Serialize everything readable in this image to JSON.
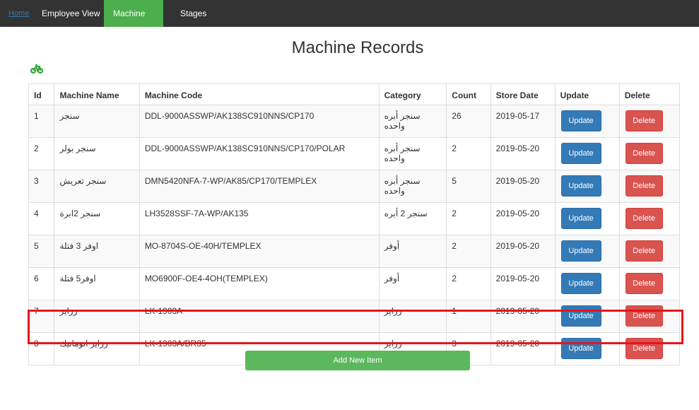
{
  "nav": {
    "home": "Home",
    "employee_view": "Employee View",
    "machine_view": "Machine View",
    "stages": "Stages"
  },
  "page_title": "Machine Records",
  "icon": "bicycle-icon",
  "table": {
    "headers": [
      "Id",
      "Machine Name",
      "Machine Code",
      "Category",
      "Count",
      "Store Date",
      "Update",
      "Delete"
    ],
    "rows": [
      {
        "id": "1",
        "name": "سنجر",
        "code": "DDL-9000ASSWP/AK138SC910NNS/CP170",
        "category": "سنجر أبره واحده",
        "count": "26",
        "date": "2019-05-17"
      },
      {
        "id": "2",
        "name": "سنجر بولر",
        "code": "DDL-9000ASSWP/AK138SC910NNS/CP170/POLAR",
        "category": "سنجر أبره واحده",
        "count": "2",
        "date": "2019-05-20"
      },
      {
        "id": "3",
        "name": "سنجر تعريش",
        "code": "DMN5420NFA-7-WP/AK85/CP170/TEMPLEX",
        "category": "سنجر أبره واحده",
        "count": "5",
        "date": "2019-05-20"
      },
      {
        "id": "4",
        "name": "سنجر 2ابرة",
        "code": "LH3528SSF-7A-WP/AK135",
        "category": "سنجر 2 أبره",
        "count": "2",
        "date": "2019-05-20"
      },
      {
        "id": "5",
        "name": "اوفر 3 فتلة",
        "code": "MO-8704S-OE-40H/TEMPLEX",
        "category": "أوفر",
        "count": "2",
        "date": "2019-05-20"
      },
      {
        "id": "6",
        "name": "اوفر5 فتلة",
        "code": "MO6900F-OE4-4OH(TEMPLEX)",
        "category": "أوفر",
        "count": "2",
        "date": "2019-05-20"
      },
      {
        "id": "7",
        "name": "زراير",
        "code": "LK-1903A",
        "category": "زراير",
        "count": "1",
        "date": "2019-05-20"
      },
      {
        "id": "8",
        "name": "زراير اتوماتيك",
        "code": "LK-1903A/BR35",
        "category": "زراير",
        "count": "3",
        "date": "2019-05-20"
      }
    ],
    "update_label": "Update",
    "delete_label": "Delete"
  },
  "add_button": "Add New Item",
  "colors": {
    "navbar": "#333333",
    "active_nav": "#4cae4c",
    "update_button": "#337ab7",
    "delete_button": "#d9534f",
    "add_button": "#5cb85c",
    "highlight": "#e8141b"
  }
}
